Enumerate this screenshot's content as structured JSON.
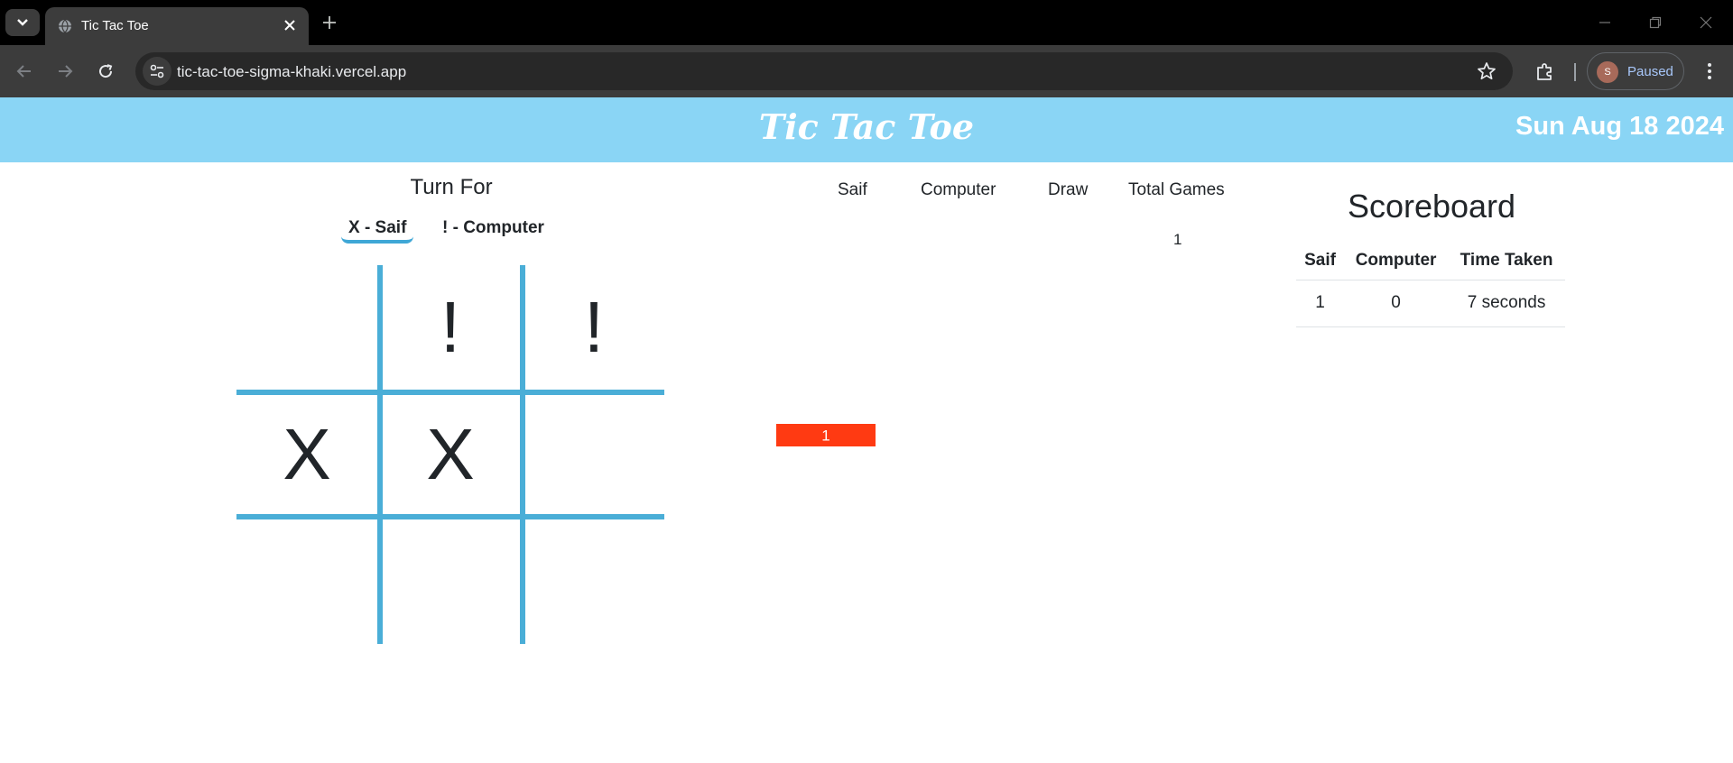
{
  "browser": {
    "tab_title": "Tic Tac Toe",
    "url": "tic-tac-toe-sigma-khaki.vercel.app",
    "profile_initial": "S",
    "profile_label": "Paused"
  },
  "header": {
    "title": "Tic Tac Toe",
    "date": "Sun Aug 18 2024"
  },
  "turn": {
    "heading": "Turn For",
    "players": [
      {
        "label": "X - Saif",
        "active": true
      },
      {
        "label": "! - Computer",
        "active": false
      }
    ]
  },
  "board": {
    "cells": [
      "",
      "!",
      "!",
      "X",
      "X",
      "",
      "",
      "",
      ""
    ]
  },
  "stats": {
    "headers": [
      "Saif",
      "Computer",
      "Draw",
      "Total Games"
    ],
    "values": [
      "",
      "",
      "",
      "1"
    ]
  },
  "chart_data": {
    "type": "bar",
    "categories": [
      "Saif",
      "Computer",
      "Draw"
    ],
    "values": [
      1,
      0,
      0
    ],
    "bar_label": "1",
    "colors": [
      "#ff3a12"
    ]
  },
  "scoreboard": {
    "title": "Scoreboard",
    "columns": [
      "Saif",
      "Computer",
      "Time Taken"
    ],
    "rows": [
      [
        "1",
        "0",
        "7 seconds"
      ]
    ]
  },
  "colors": {
    "header_bg": "#8ad5f5",
    "grid": "#4aaed7",
    "bar": "#ff3a12"
  }
}
